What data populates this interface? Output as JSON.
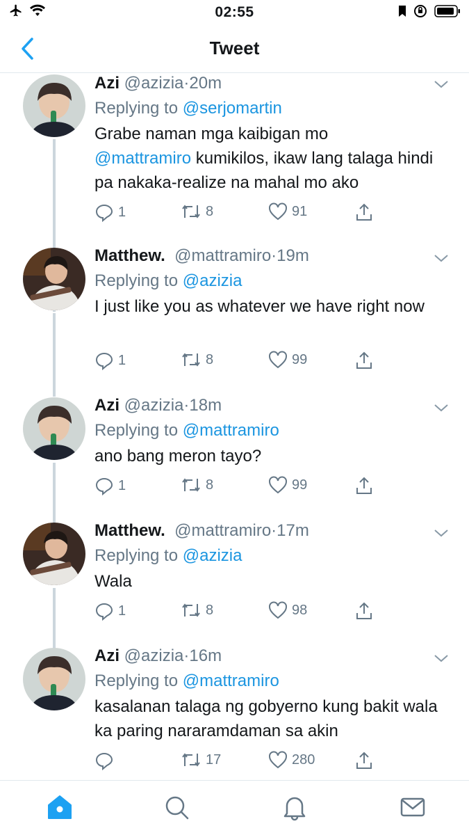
{
  "status_bar": {
    "time": "02:55"
  },
  "header": {
    "title": "Tweet"
  },
  "tweets": [
    {
      "name": "Azi",
      "handle": "@azizia",
      "time": "20m",
      "replying_prefix": "Replying to ",
      "replying_to": "@serjomartin",
      "text_line1_mention": "",
      "text_a": "Grabe naman mga kaibigan mo",
      "text_mention": "@mattramiro",
      "text_b": " kumikilos, ikaw lang talaga hindi pa nakaka-realize na mahal mo ako",
      "replies": "1",
      "retweets": "8",
      "likes": "91",
      "avatar": "azi"
    },
    {
      "name": "Matthew.",
      "handle": "@mattramiro",
      "time": "19m",
      "replying_prefix": "Replying to ",
      "replying_to": "@azizia",
      "text_a": "I just like you as whatever we have right now",
      "text_mention": "",
      "text_b": "",
      "replies": "1",
      "retweets": "8",
      "likes": "99",
      "avatar": "matt"
    },
    {
      "name": "Azi",
      "handle": "@azizia",
      "time": "18m",
      "replying_prefix": "Replying to ",
      "replying_to": "@mattramiro",
      "text_a": "ano bang meron tayo?",
      "text_mention": "",
      "text_b": "",
      "replies": "1",
      "retweets": "8",
      "likes": "99",
      "avatar": "azi"
    },
    {
      "name": "Matthew.",
      "handle": "@mattramiro",
      "time": "17m",
      "replying_prefix": "Replying to ",
      "replying_to": "@azizia",
      "text_a": "Wala",
      "text_mention": "",
      "text_b": "",
      "replies": "1",
      "retweets": "8",
      "likes": "98",
      "avatar": "matt"
    },
    {
      "name": "Azi",
      "handle": "@azizia",
      "time": "16m",
      "replying_prefix": "Replying to ",
      "replying_to": "@mattramiro",
      "text_a": "kasalanan talaga ng gobyerno kung bakit wala ka paring nararamdaman sa akin",
      "text_mention": "",
      "text_b": "",
      "replies": "",
      "retweets": "17",
      "likes": "280",
      "avatar": "azi"
    }
  ],
  "tabs": [
    "home-icon",
    "search-icon",
    "notifications-icon",
    "messages-icon"
  ],
  "colors": {
    "accent": "#1da1f2",
    "mention": "#1b95e0",
    "muted": "#657786",
    "divider": "#e1e8ed"
  }
}
